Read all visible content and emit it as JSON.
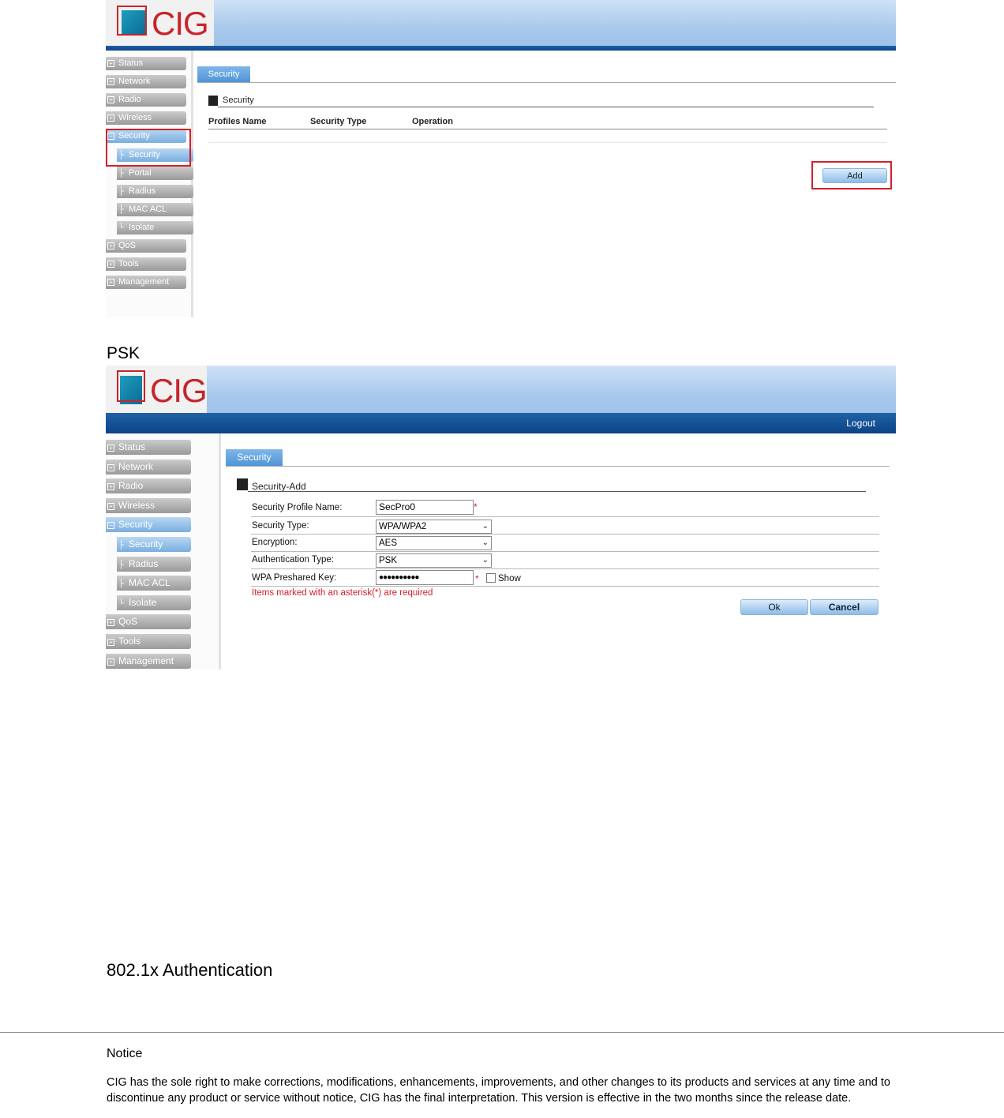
{
  "screenshot1": {
    "logo_text": "CIG",
    "menu": [
      {
        "label": "Status",
        "sign": "⊞"
      },
      {
        "label": "Network",
        "sign": "⊞"
      },
      {
        "label": "Radio",
        "sign": "⊞"
      },
      {
        "label": "Wireless",
        "sign": "⊞"
      },
      {
        "label": "Security",
        "sign": "⊟"
      },
      {
        "label": "Security",
        "tree": "├"
      },
      {
        "label": "Portal",
        "tree": "├"
      },
      {
        "label": "Radius",
        "tree": "├"
      },
      {
        "label": "MAC ACL",
        "tree": "├"
      },
      {
        "label": "Isolate",
        "tree": "└"
      },
      {
        "label": "QoS",
        "sign": "⊞"
      },
      {
        "label": "Tools",
        "sign": "⊞"
      },
      {
        "label": "Management",
        "sign": "⊞"
      }
    ],
    "tab": "Security",
    "section_title": "Security",
    "columns": [
      "Profiles Name",
      "Security Type",
      "Operation"
    ],
    "add_button": "Add"
  },
  "psk_heading": "PSK",
  "screenshot2": {
    "logo_text": "CIG",
    "logout": "Logout",
    "menu": [
      {
        "label": "Status",
        "sign": "⊞"
      },
      {
        "label": "Network",
        "sign": "⊞"
      },
      {
        "label": "Radio",
        "sign": "⊞"
      },
      {
        "label": "Wireless",
        "sign": "⊞"
      },
      {
        "label": "Security",
        "sign": "⊟"
      },
      {
        "label": "Security",
        "tree": "├"
      },
      {
        "label": "Radius",
        "tree": "├"
      },
      {
        "label": "MAC ACL",
        "tree": "├"
      },
      {
        "label": "Isolate",
        "tree": "└"
      },
      {
        "label": "QoS",
        "sign": "⊞"
      },
      {
        "label": "Tools",
        "sign": "⊞"
      },
      {
        "label": "Management",
        "sign": "⊞"
      }
    ],
    "tab": "Security",
    "section_title": "Security-Add",
    "form": {
      "profile_name_label": "Security Profile Name:",
      "profile_name_value": "SecPro0",
      "security_type_label": "Security Type:",
      "security_type_value": "WPA/WPA2",
      "encryption_label": "Encryption:",
      "encryption_value": "AES",
      "auth_type_label": "Authentication Type:",
      "auth_type_value": "PSK",
      "psk_label": "WPA Preshared Key:",
      "psk_value": "●●●●●●●●●●",
      "show_label": "Show",
      "asterisk": "*",
      "required_note": "Items marked with an asterisk(*) are required"
    },
    "ok_button": "Ok",
    "cancel_button": "Cancel"
  },
  "auth_heading": "802.1x Authentication",
  "notice": {
    "title": "Notice",
    "text": "CIG has the sole right to make corrections, modifications, enhancements, improvements, and other changes to its products and services at any time and to discontinue any product or service without notice, CIG has the final interpretation. This version is effective in the two months since the release date."
  },
  "colors": {
    "banner": "#a9c9ec",
    "navbar": "#0b4486",
    "brand_red": "#c8242a",
    "tab_blue": "#4f93d6",
    "highlight_red": "#d4202a"
  }
}
